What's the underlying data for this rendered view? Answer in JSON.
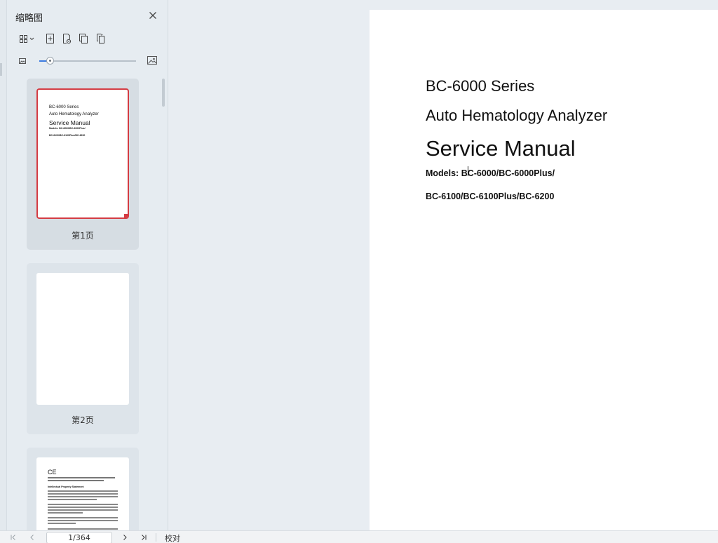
{
  "panel": {
    "title": "缩略图",
    "toolbar": {
      "icons": [
        "grid-view-icon",
        "chevron-down-icon",
        "insert-page-icon",
        "extract-page-icon",
        "copy-page-icon",
        "replace-page-icon"
      ]
    },
    "zoom": {
      "min_icon": "image-small-icon",
      "max_icon": "image-large-icon",
      "value": 0.1
    }
  },
  "thumbnails": [
    {
      "label": "第1页",
      "selected": true,
      "lines": [
        "BC-6000 Series",
        "Auto Hematology Analyzer",
        "Service Manual",
        "Models: BC-6000/BC-6000Plus/",
        "BC-6100/BC-6100Plus/BC-6200"
      ]
    },
    {
      "label": "第2页",
      "selected": false
    },
    {
      "label": "",
      "selected": false,
      "mark": "CE",
      "heading": "Intellectual Property Statement"
    }
  ],
  "document": {
    "series": "BC-6000 Series",
    "product": "Auto Hematology Analyzer",
    "title": "Service Manual",
    "models_line1": "Models: BC-6000/BC-6000Plus/",
    "models_line2": "BC-6100/BC-6100Plus/BC-6200"
  },
  "statusbar": {
    "page_indicator": "1/364",
    "proof_label": "校对"
  },
  "colors": {
    "accent": "#3d7ce0",
    "selection_border": "#d43c43"
  }
}
